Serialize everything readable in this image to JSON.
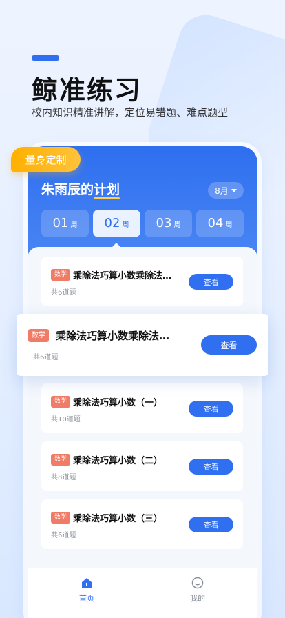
{
  "hero": {
    "title": "鲸准练习",
    "subtitle": "校内知识精准讲解，定位易错题、难点题型"
  },
  "badge": {
    "label": "量身定制"
  },
  "plan": {
    "title_prefix": "朱雨辰的",
    "title_highlight": "计划",
    "month": "8月"
  },
  "weeks": [
    {
      "num": "01",
      "unit": "周"
    },
    {
      "num": "02",
      "unit": "周",
      "active": true
    },
    {
      "num": "03",
      "unit": "周"
    },
    {
      "num": "04",
      "unit": "周"
    }
  ],
  "cards": [
    {
      "tag": "数学",
      "title": "乘除法巧算小数乘除法…",
      "count": "共6道题",
      "action": "查看"
    },
    {
      "tag": "数学",
      "title": "乘除法巧算小数（一）",
      "count": "共10道题",
      "action": "查看"
    },
    {
      "tag": "数学",
      "title": "乘除法巧算小数（二）",
      "count": "共8道题",
      "action": "查看"
    },
    {
      "tag": "数学",
      "title": "乘除法巧算小数（三）",
      "count": "共6道题",
      "action": "查看"
    }
  ],
  "float_card": {
    "tag": "数学",
    "title": "乘除法巧算小数乘除法…",
    "count": "共6道题",
    "action": "查看"
  },
  "tabbar": {
    "home": "首页",
    "mine": "我的"
  },
  "colors": {
    "primary": "#2f6ff0",
    "tag": "#f07b67",
    "badge": "#ffb000"
  }
}
